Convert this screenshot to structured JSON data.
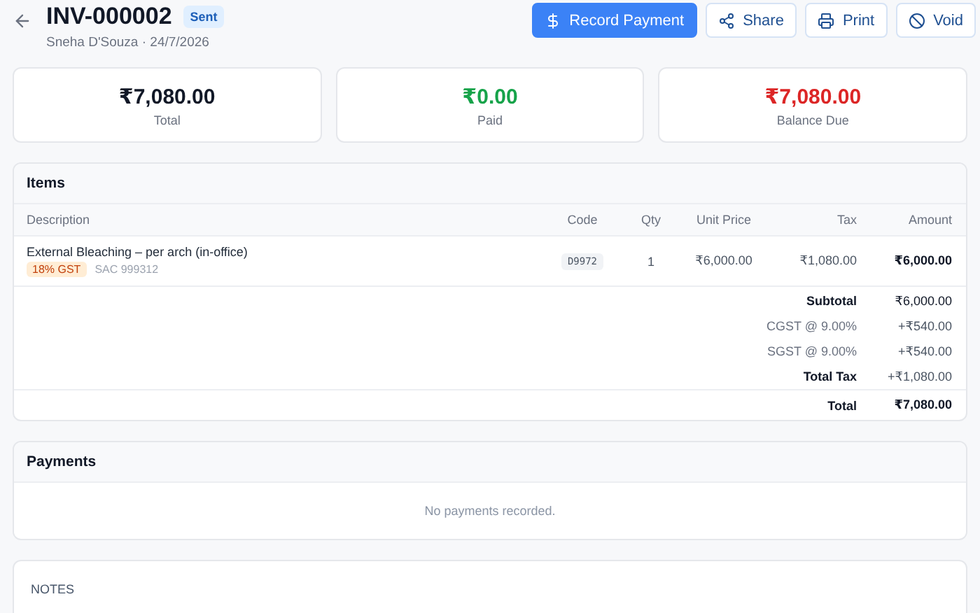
{
  "header": {
    "title": "INV-000002",
    "status": "Sent",
    "subtitle": "Sneha D'Souza · 24/7/2026"
  },
  "actions": [
    {
      "kind": "dollar",
      "label": "Record Payment",
      "primary": true
    },
    {
      "kind": "share",
      "label": "Share",
      "primary": false
    },
    {
      "kind": "print",
      "label": "Print",
      "primary": false
    },
    {
      "kind": "void",
      "label": "Void",
      "primary": false
    }
  ],
  "summary": [
    {
      "kind": "neutral",
      "amount": "₹7,080.00",
      "label": "Total"
    },
    {
      "kind": "positive",
      "amount": "₹0.00",
      "label": "Paid"
    },
    {
      "kind": "negative",
      "amount": "₹7,080.00",
      "label": "Balance Due"
    }
  ],
  "items": {
    "title": "Items",
    "columns": [
      "Description",
      "Code",
      "Qty",
      "Unit Price",
      "Tax",
      "Amount"
    ],
    "rows": [
      {
        "description": "External Bleaching – per arch (in-office)",
        "tax_badge": "18% GST",
        "sac": "SAC 999312",
        "code": "D9972",
        "qty": "1",
        "unit_price": "₹6,000.00",
        "tax": "₹1,080.00",
        "amount": "₹6,000.00"
      }
    ],
    "totals": [
      {
        "kind": "subtotal",
        "label": "Subtotal",
        "value": "₹6,000.00"
      },
      {
        "kind": "tax",
        "label": "CGST @ 9.00%",
        "value": "+₹540.00"
      },
      {
        "kind": "tax",
        "label": "SGST @ 9.00%",
        "value": "+₹540.00"
      },
      {
        "kind": "taxtotal",
        "label": "Total Tax",
        "value": "+₹1,080.00"
      },
      {
        "kind": "grand",
        "label": "Total",
        "value": "₹7,080.00"
      }
    ]
  },
  "payments": {
    "title": "Payments",
    "empty": "No payments recorded."
  },
  "notes": {
    "title": "NOTES"
  }
}
